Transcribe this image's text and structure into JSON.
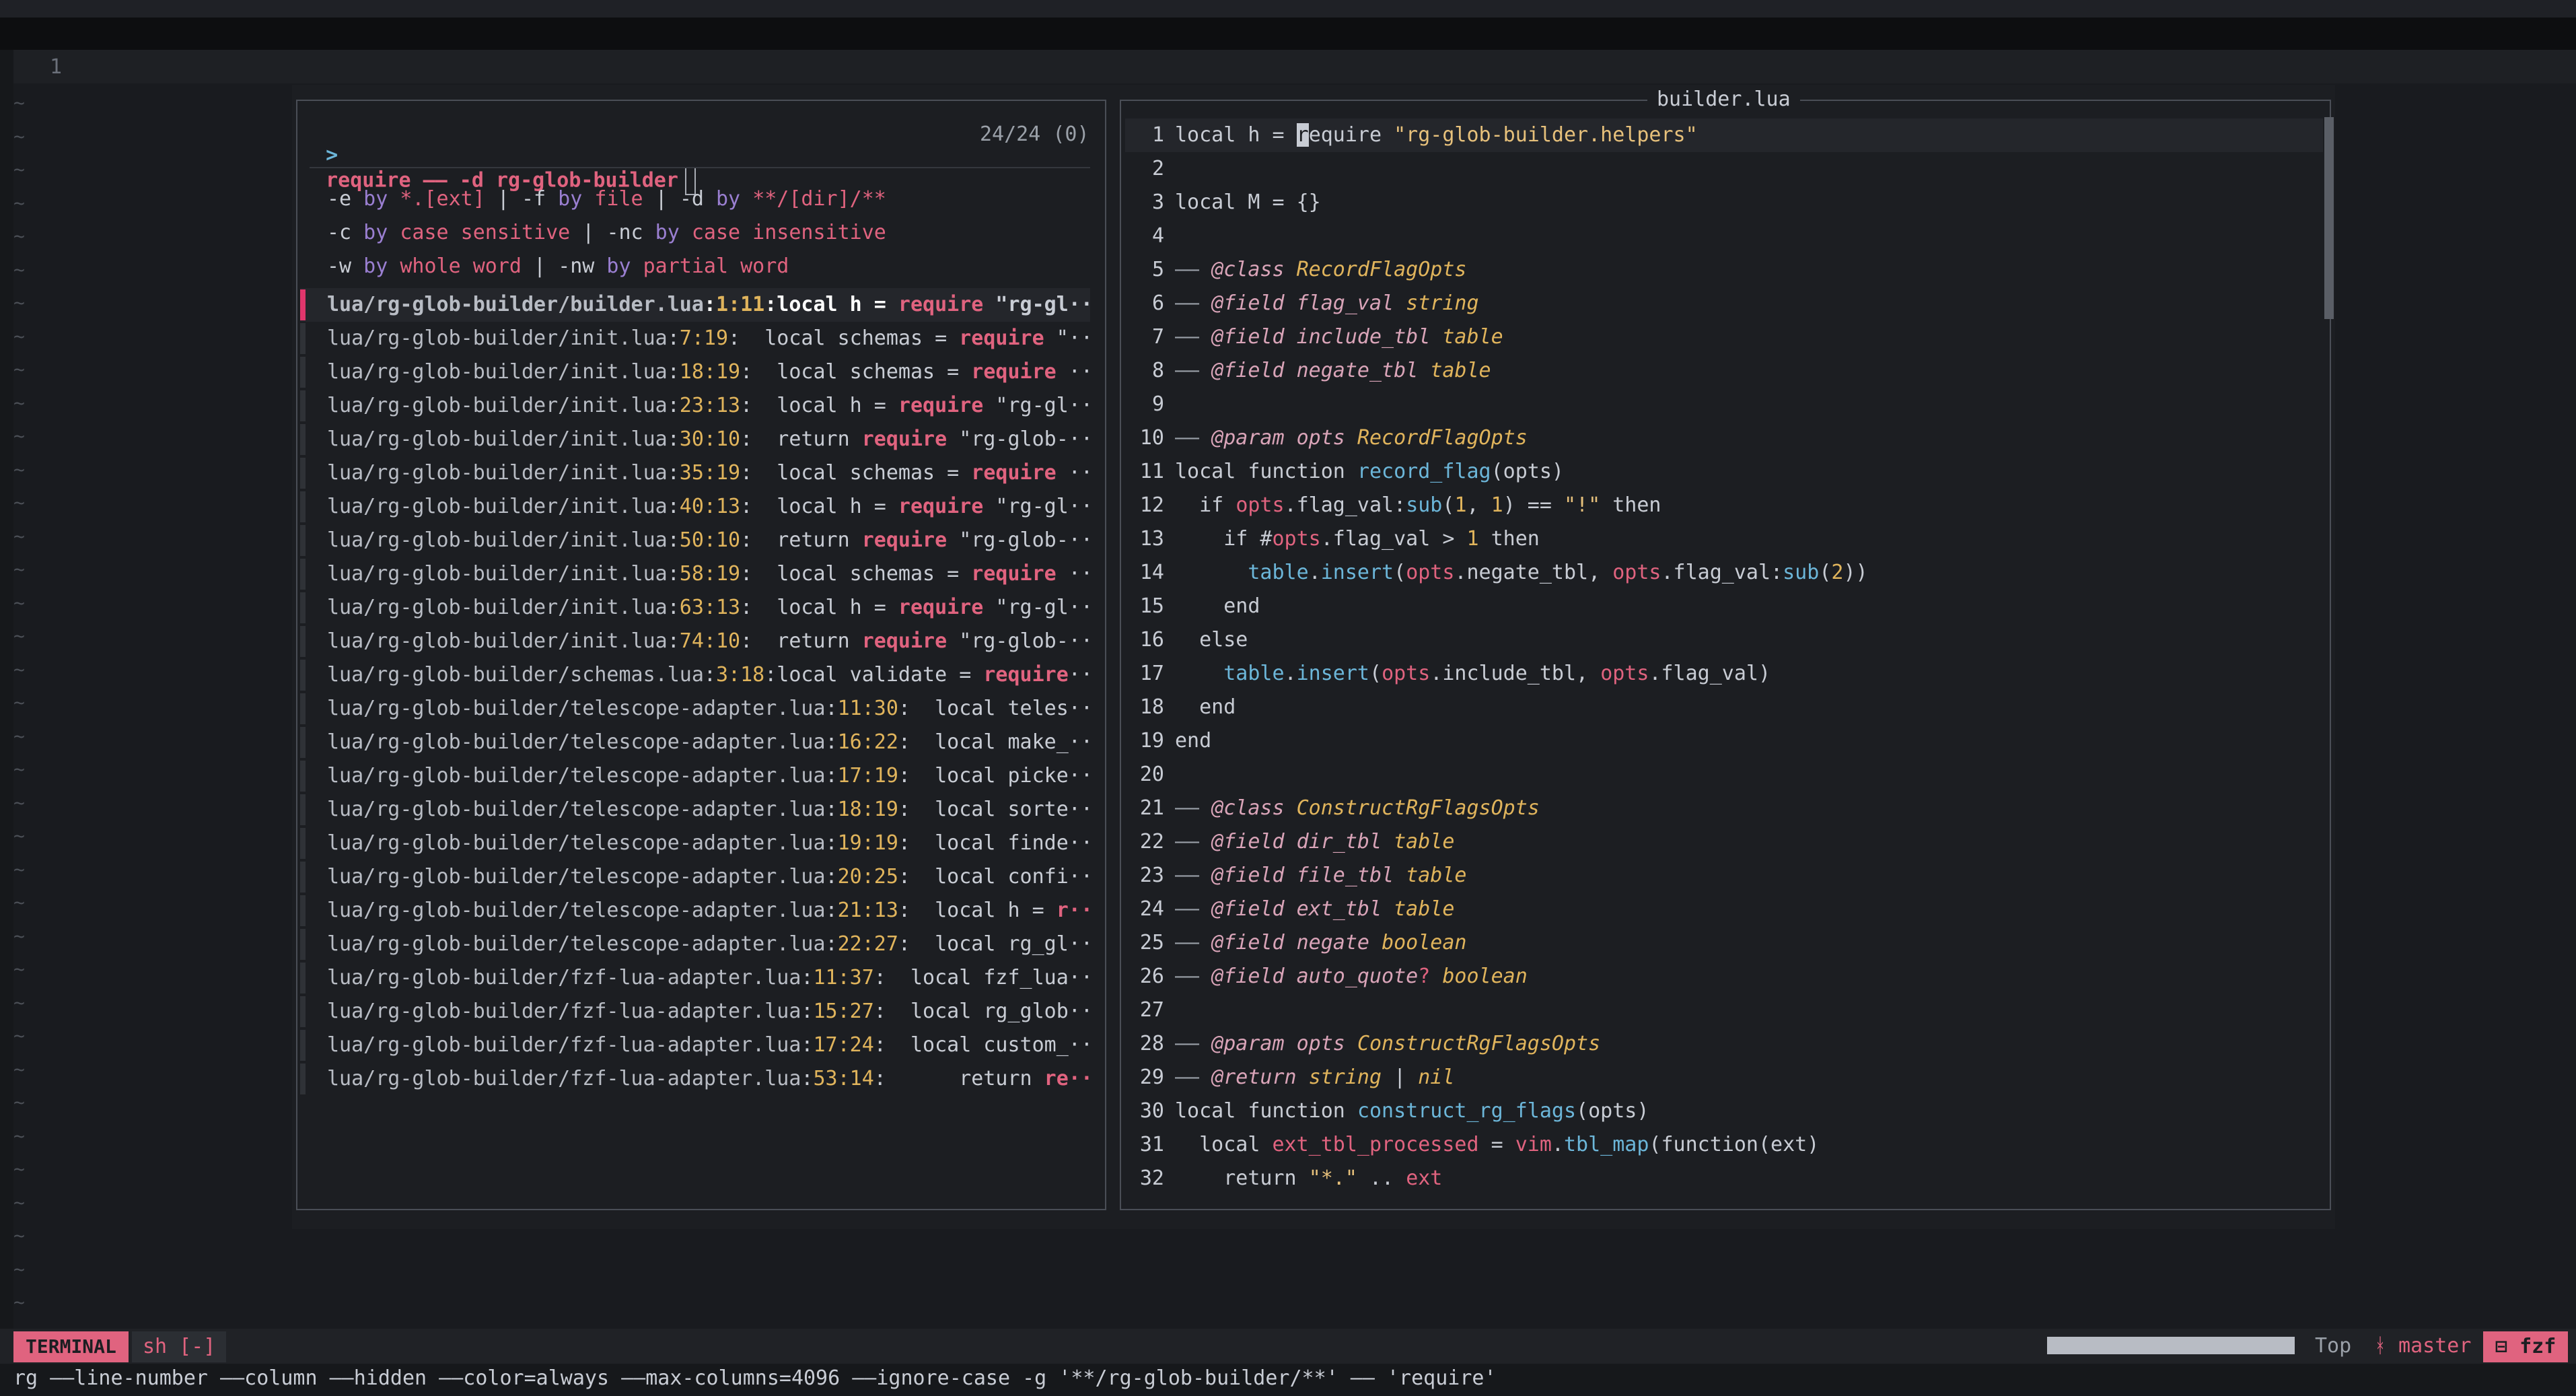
{
  "editor": {
    "line_number": "1",
    "tilde": "~"
  },
  "fzf": {
    "prompt_arrow": ">",
    "prompt_query": "require —— -d rg-glob-builder",
    "count": "24/24 (0)",
    "hints": [
      [
        [
          "-e",
          "w"
        ],
        [
          " by ",
          "y0"
        ],
        [
          "*.[ext]",
          "r"
        ],
        [
          " | ",
          "w"
        ],
        [
          "-f",
          "w"
        ],
        [
          " by ",
          "y0"
        ],
        [
          "file",
          "r"
        ],
        [
          " | ",
          "w"
        ],
        [
          "-d",
          "w"
        ],
        [
          " by ",
          "y0"
        ],
        [
          "**/[dir]/**",
          "r"
        ]
      ],
      [
        [
          "-c",
          "w"
        ],
        [
          " by ",
          "y0"
        ],
        [
          "case sensitive",
          "r"
        ],
        [
          " | ",
          "w"
        ],
        [
          "-nc",
          "w"
        ],
        [
          " by ",
          "y0"
        ],
        [
          "case insensitive",
          "r"
        ]
      ],
      [
        [
          "-w",
          "w"
        ],
        [
          " by ",
          "y0"
        ],
        [
          "whole word",
          "r"
        ],
        [
          " | ",
          "w"
        ],
        [
          "-nw",
          "w"
        ],
        [
          " by ",
          "y0"
        ],
        [
          "partial word",
          "r"
        ]
      ]
    ],
    "results": [
      {
        "path": "lua/rg-glob-builder/builder.lua",
        "loc": "1:11",
        "pre": "local h = ",
        "req": "require",
        "post": " \"rg-gl··",
        "selected": true
      },
      {
        "path": "lua/rg-glob-builder/init.lua",
        "loc": "7:19",
        "pre": "  local schemas = ",
        "req": "require",
        "post": " \"··"
      },
      {
        "path": "lua/rg-glob-builder/init.lua",
        "loc": "18:19",
        "pre": "  local schemas = ",
        "req": "require",
        "post": " ··"
      },
      {
        "path": "lua/rg-glob-builder/init.lua",
        "loc": "23:13",
        "pre": "  local h = ",
        "req": "require",
        "post": " \"rg-gl··"
      },
      {
        "path": "lua/rg-glob-builder/init.lua",
        "loc": "30:10",
        "pre": "  return ",
        "req": "require",
        "post": " \"rg-glob-··"
      },
      {
        "path": "lua/rg-glob-builder/init.lua",
        "loc": "35:19",
        "pre": "  local schemas = ",
        "req": "require",
        "post": " ··"
      },
      {
        "path": "lua/rg-glob-builder/init.lua",
        "loc": "40:13",
        "pre": "  local h = ",
        "req": "require",
        "post": " \"rg-gl··"
      },
      {
        "path": "lua/rg-glob-builder/init.lua",
        "loc": "50:10",
        "pre": "  return ",
        "req": "require",
        "post": " \"rg-glob-··"
      },
      {
        "path": "lua/rg-glob-builder/init.lua",
        "loc": "58:19",
        "pre": "  local schemas = ",
        "req": "require",
        "post": " ··"
      },
      {
        "path": "lua/rg-glob-builder/init.lua",
        "loc": "63:13",
        "pre": "  local h = ",
        "req": "require",
        "post": " \"rg-gl··"
      },
      {
        "path": "lua/rg-glob-builder/init.lua",
        "loc": "74:10",
        "pre": "  return ",
        "req": "require",
        "post": " \"rg-glob-··"
      },
      {
        "path": "lua/rg-glob-builder/schemas.lua",
        "loc": "3:18",
        "pre": "local validate = ",
        "req": "require",
        "post": "··"
      },
      {
        "path": "lua/rg-glob-builder/telescope-adapter.lua",
        "loc": "11:30",
        "pre": "  local teles··",
        "req": "",
        "post": ""
      },
      {
        "path": "lua/rg-glob-builder/telescope-adapter.lua",
        "loc": "16:22",
        "pre": "  local make_··",
        "req": "",
        "post": ""
      },
      {
        "path": "lua/rg-glob-builder/telescope-adapter.lua",
        "loc": "17:19",
        "pre": "  local picke··",
        "req": "",
        "post": ""
      },
      {
        "path": "lua/rg-glob-builder/telescope-adapter.lua",
        "loc": "18:19",
        "pre": "  local sorte··",
        "req": "",
        "post": ""
      },
      {
        "path": "lua/rg-glob-builder/telescope-adapter.lua",
        "loc": "19:19",
        "pre": "  local finde··",
        "req": "",
        "post": ""
      },
      {
        "path": "lua/rg-glob-builder/telescope-adapter.lua",
        "loc": "20:25",
        "pre": "  local confi··",
        "req": "",
        "post": ""
      },
      {
        "path": "lua/rg-glob-builder/telescope-adapter.lua",
        "loc": "21:13",
        "pre": "  local h = ",
        "req": "r··",
        "post": ""
      },
      {
        "path": "lua/rg-glob-builder/telescope-adapter.lua",
        "loc": "22:27",
        "pre": "  local rg_gl··",
        "req": "",
        "post": ""
      },
      {
        "path": "lua/rg-glob-builder/fzf-lua-adapter.lua",
        "loc": "11:37",
        "pre": "  local fzf_lua··",
        "req": "",
        "post": ""
      },
      {
        "path": "lua/rg-glob-builder/fzf-lua-adapter.lua",
        "loc": "15:27",
        "pre": "  local rg_glob··",
        "req": "",
        "post": ""
      },
      {
        "path": "lua/rg-glob-builder/fzf-lua-adapter.lua",
        "loc": "17:24",
        "pre": "  local custom_··",
        "req": "",
        "post": ""
      },
      {
        "path": "lua/rg-glob-builder/fzf-lua-adapter.lua",
        "loc": "53:14",
        "pre": "      return ",
        "req": "re··",
        "post": ""
      }
    ]
  },
  "preview": {
    "title": "builder.lua",
    "lines": [
      {
        "n": "1",
        "cur": true,
        "seg": [
          [
            "local h = ",
            "kw"
          ],
          [
            "r",
            "cb"
          ],
          [
            "equire ",
            "kw"
          ],
          [
            "\"rg-glob-builder.helpers\"",
            "str"
          ]
        ]
      },
      {
        "n": "2",
        "seg": []
      },
      {
        "n": "3",
        "seg": [
          [
            "local M = {}",
            "kw"
          ]
        ]
      },
      {
        "n": "4",
        "seg": []
      },
      {
        "n": "5",
        "seg": [
          [
            "—— ",
            "cm"
          ],
          [
            "@class ",
            "pa"
          ],
          [
            "RecordFlagOpts",
            "ty"
          ]
        ]
      },
      {
        "n": "6",
        "seg": [
          [
            "—— ",
            "cm"
          ],
          [
            "@field ",
            "pa"
          ],
          [
            "flag_val ",
            "pa"
          ],
          [
            "string",
            "ty"
          ]
        ]
      },
      {
        "n": "7",
        "seg": [
          [
            "—— ",
            "cm"
          ],
          [
            "@field ",
            "pa"
          ],
          [
            "include_tbl ",
            "pa"
          ],
          [
            "table",
            "ty"
          ]
        ]
      },
      {
        "n": "8",
        "seg": [
          [
            "—— ",
            "cm"
          ],
          [
            "@field ",
            "pa"
          ],
          [
            "negate_tbl ",
            "pa"
          ],
          [
            "table",
            "ty"
          ]
        ]
      },
      {
        "n": "9",
        "seg": []
      },
      {
        "n": "10",
        "seg": [
          [
            "—— ",
            "cm"
          ],
          [
            "@param ",
            "pa"
          ],
          [
            "opts ",
            "pa"
          ],
          [
            "RecordFlagOpts",
            "ty"
          ]
        ]
      },
      {
        "n": "11",
        "seg": [
          [
            "local function ",
            "kw"
          ],
          [
            "record_flag",
            "fn"
          ],
          [
            "(opts)",
            "kw"
          ]
        ]
      },
      {
        "n": "12",
        "seg": [
          [
            "  if ",
            "kw"
          ],
          [
            "opts",
            "op"
          ],
          [
            ".flag_val:",
            "kw"
          ],
          [
            "sub",
            "fn"
          ],
          [
            "(",
            "kw"
          ],
          [
            "1",
            "nm"
          ],
          [
            ", ",
            "kw"
          ],
          [
            "1",
            "nm"
          ],
          [
            ") == ",
            "kw"
          ],
          [
            "\"!\"",
            "str"
          ],
          [
            " then",
            "kw"
          ]
        ]
      },
      {
        "n": "13",
        "seg": [
          [
            "    if #",
            "kw"
          ],
          [
            "opts",
            "op"
          ],
          [
            ".flag_val > ",
            "kw"
          ],
          [
            "1",
            "nm"
          ],
          [
            " then",
            "kw"
          ]
        ]
      },
      {
        "n": "14",
        "seg": [
          [
            "      table",
            "fn"
          ],
          [
            ".",
            "kw"
          ],
          [
            "insert",
            "fn"
          ],
          [
            "(",
            "kw"
          ],
          [
            "opts",
            "op"
          ],
          [
            ".negate_tbl, ",
            "kw"
          ],
          [
            "opts",
            "op"
          ],
          [
            ".flag_val:",
            "kw"
          ],
          [
            "sub",
            "fn"
          ],
          [
            "(",
            "kw"
          ],
          [
            "2",
            "nm"
          ],
          [
            "))",
            "kw"
          ]
        ]
      },
      {
        "n": "15",
        "seg": [
          [
            "    end",
            "kw"
          ]
        ]
      },
      {
        "n": "16",
        "seg": [
          [
            "  else",
            "kw"
          ]
        ]
      },
      {
        "n": "17",
        "seg": [
          [
            "    table",
            "fn"
          ],
          [
            ".",
            "kw"
          ],
          [
            "insert",
            "fn"
          ],
          [
            "(",
            "kw"
          ],
          [
            "opts",
            "op"
          ],
          [
            ".include_tbl, ",
            "kw"
          ],
          [
            "opts",
            "op"
          ],
          [
            ".flag_val)",
            "kw"
          ]
        ]
      },
      {
        "n": "18",
        "seg": [
          [
            "  end",
            "kw"
          ]
        ]
      },
      {
        "n": "19",
        "seg": [
          [
            "end",
            "kw"
          ]
        ]
      },
      {
        "n": "20",
        "seg": []
      },
      {
        "n": "21",
        "seg": [
          [
            "—— ",
            "cm"
          ],
          [
            "@class ",
            "pa"
          ],
          [
            "ConstructRgFlagsOpts",
            "ty"
          ]
        ]
      },
      {
        "n": "22",
        "seg": [
          [
            "—— ",
            "cm"
          ],
          [
            "@field ",
            "pa"
          ],
          [
            "dir_tbl ",
            "pa"
          ],
          [
            "table",
            "ty"
          ]
        ]
      },
      {
        "n": "23",
        "seg": [
          [
            "—— ",
            "cm"
          ],
          [
            "@field ",
            "pa"
          ],
          [
            "file_tbl ",
            "pa"
          ],
          [
            "table",
            "ty"
          ]
        ]
      },
      {
        "n": "24",
        "seg": [
          [
            "—— ",
            "cm"
          ],
          [
            "@field ",
            "pa"
          ],
          [
            "ext_tbl ",
            "pa"
          ],
          [
            "table",
            "ty"
          ]
        ]
      },
      {
        "n": "25",
        "seg": [
          [
            "—— ",
            "cm"
          ],
          [
            "@field ",
            "pa"
          ],
          [
            "negate ",
            "pa"
          ],
          [
            "boolean",
            "ty"
          ]
        ]
      },
      {
        "n": "26",
        "seg": [
          [
            "—— ",
            "cm"
          ],
          [
            "@field ",
            "pa"
          ],
          [
            "auto_quote",
            "pa"
          ],
          [
            "? ",
            "op"
          ],
          [
            "boolean",
            "ty"
          ]
        ]
      },
      {
        "n": "27",
        "seg": []
      },
      {
        "n": "28",
        "seg": [
          [
            "—— ",
            "cm"
          ],
          [
            "@param ",
            "pa"
          ],
          [
            "opts ",
            "pa"
          ],
          [
            "ConstructRgFlagsOpts",
            "ty"
          ]
        ]
      },
      {
        "n": "29",
        "seg": [
          [
            "—— ",
            "cm"
          ],
          [
            "@return ",
            "pa"
          ],
          [
            "string ",
            "ty"
          ],
          [
            "| ",
            "kw"
          ],
          [
            "nil",
            "ty"
          ]
        ]
      },
      {
        "n": "30",
        "seg": [
          [
            "local function ",
            "kw"
          ],
          [
            "construct_rg_flags",
            "fn"
          ],
          [
            "(opts)",
            "kw"
          ]
        ]
      },
      {
        "n": "31",
        "seg": [
          [
            "  local ",
            "kw"
          ],
          [
            "ext_tbl_processed",
            "op"
          ],
          [
            " = ",
            "kw"
          ],
          [
            "vim",
            "op"
          ],
          [
            ".",
            "kw"
          ],
          [
            "tbl_map",
            "fn"
          ],
          [
            "(function(ext)",
            "kw"
          ]
        ]
      },
      {
        "n": "32",
        "seg": [
          [
            "    return ",
            "kw"
          ],
          [
            "\"*.\"",
            "str"
          ],
          [
            " .. ",
            "kw"
          ],
          [
            "ext",
            "op"
          ]
        ]
      }
    ]
  },
  "statusline": {
    "mode": "TERMINAL",
    "buffer": "sh [-]",
    "position": "Top",
    "branch": "ᚼ master",
    "plugin": "⊟ fzf"
  },
  "cmdline": "rg ——line-number ——column ——hidden ——color=always ——max-columns=4096 ——ignore-case -g '**/rg-glob-builder/**' —— 'require'",
  "colors": {
    "accent": "#e0637f",
    "selection": "#e0366c",
    "yellow": "#e0b45c",
    "blue": "#6cb6d9"
  }
}
